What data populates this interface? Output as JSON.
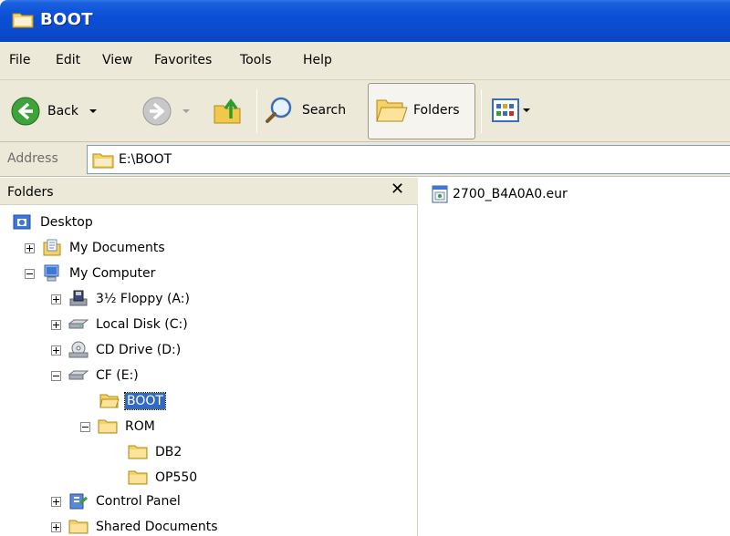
{
  "window": {
    "title": "BOOT"
  },
  "menu": [
    "File",
    "Edit",
    "View",
    "Favorites",
    "Tools",
    "Help"
  ],
  "toolbar": {
    "back_label": "Back",
    "search_label": "Search",
    "folders_label": "Folders"
  },
  "address": {
    "label": "Address",
    "value": "E:\\BOOT"
  },
  "folders_pane": {
    "title": "Folders",
    "close_glyph": "✕",
    "tree": [
      {
        "label": "Desktop",
        "icon": "desktop-icon"
      },
      {
        "label": "My Documents",
        "icon": "my-documents-icon",
        "expander": "plus"
      },
      {
        "label": "My Computer",
        "icon": "my-computer-icon",
        "expander": "minus"
      },
      {
        "label": "3½ Floppy (A:)",
        "icon": "floppy-drive-icon",
        "expander": "plus"
      },
      {
        "label": "Local Disk (C:)",
        "icon": "hard-disk-icon",
        "expander": "plus"
      },
      {
        "label": "CD Drive (D:)",
        "icon": "cd-drive-icon",
        "expander": "plus"
      },
      {
        "label": "CF (E:)",
        "icon": "removable-drive-icon",
        "expander": "minus"
      },
      {
        "label": "BOOT",
        "icon": "open-folder-icon",
        "selected": true
      },
      {
        "label": "ROM",
        "icon": "folder-icon",
        "expander": "minus"
      },
      {
        "label": "DB2",
        "icon": "folder-icon"
      },
      {
        "label": "OP550",
        "icon": "folder-icon"
      },
      {
        "label": "Control Panel",
        "icon": "control-panel-icon",
        "expander": "plus"
      },
      {
        "label": "Shared Documents",
        "icon": "folder-icon",
        "expander": "plus"
      }
    ]
  },
  "files": [
    {
      "name": "2700_B4A0A0.eur",
      "icon": "file-icon"
    }
  ],
  "colors": {
    "titlebar": "#0a4fd6",
    "selection": "#316ac5",
    "chrome": "#ece9d8"
  }
}
